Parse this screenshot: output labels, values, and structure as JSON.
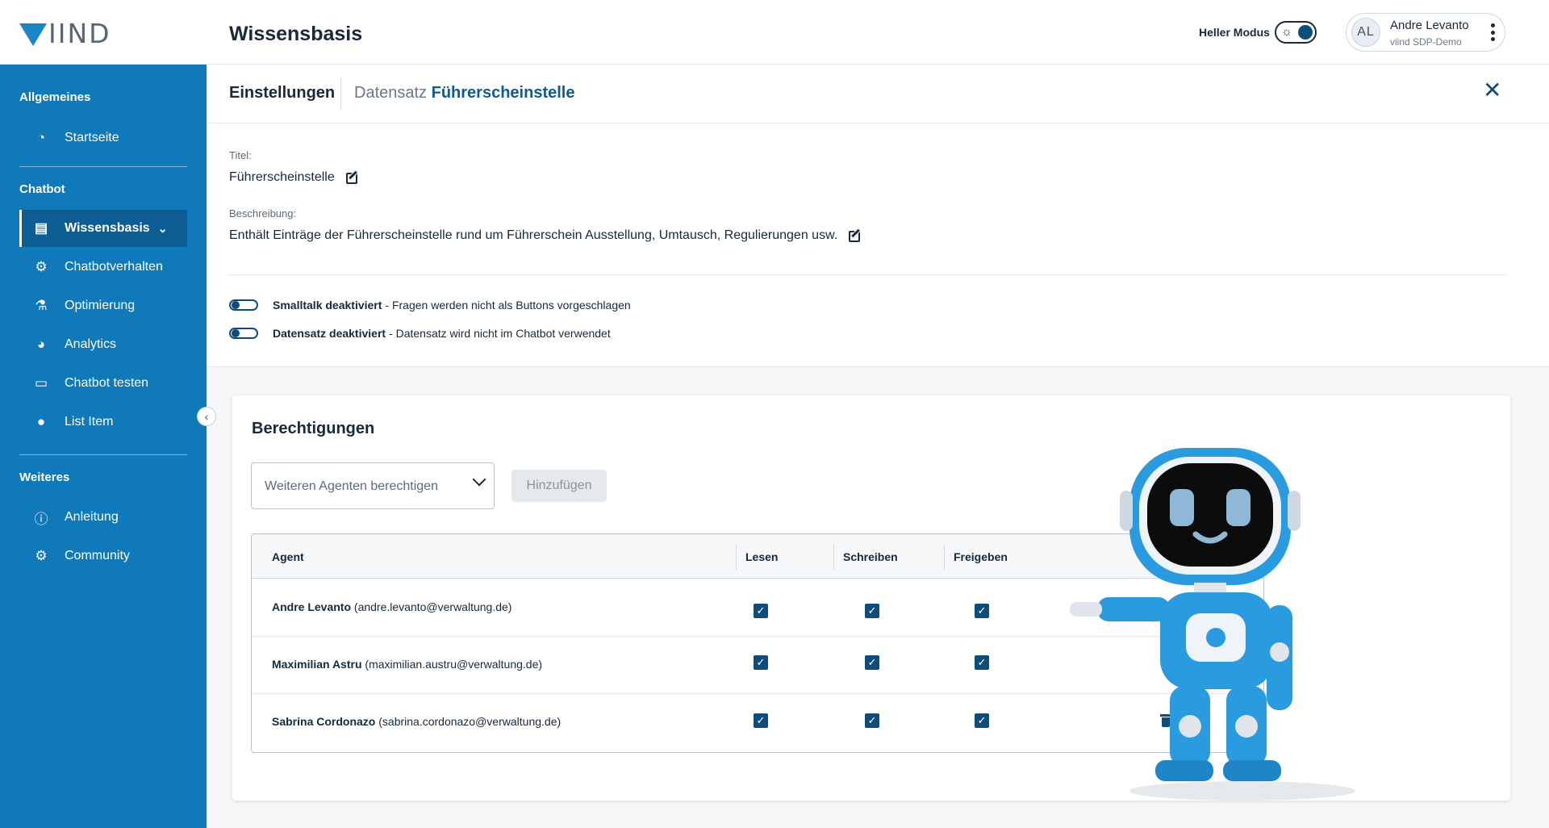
{
  "app": {
    "logo": "IIND",
    "page_title": "Wissensbasis"
  },
  "header": {
    "mode_label": "Heller Modus",
    "user": {
      "initials": "AL",
      "name": "Andre Levanto",
      "org": "viind SDP-Demo"
    }
  },
  "sidebar": {
    "sections": [
      {
        "title": "Allgemeines"
      },
      {
        "title": "Chatbot"
      },
      {
        "title": "Weiteres"
      }
    ],
    "items": [
      {
        "label": "Startseite",
        "icon": "dashboard-icon"
      },
      {
        "label": "Wissensbasis",
        "icon": "book-icon",
        "active": true
      },
      {
        "label": "Chatbotverhalten",
        "icon": "gears-icon"
      },
      {
        "label": "Optimierung",
        "icon": "microscope-icon"
      },
      {
        "label": "Analytics",
        "icon": "pie-chart-icon"
      },
      {
        "label": "Chatbot testen",
        "icon": "robot-face-icon"
      },
      {
        "label": "List Item",
        "icon": "circle-icon"
      },
      {
        "label": "Anleitung",
        "icon": "help-icon"
      },
      {
        "label": "Community",
        "icon": "gears-icon"
      }
    ]
  },
  "settings": {
    "title": "Einstellungen",
    "dataset_prefix": "Datensatz",
    "dataset_name": "Führerscheinstelle",
    "title_label": "Titel:",
    "title_value": "Führerscheinstelle",
    "desc_label": "Beschreibung:",
    "desc_value": "Enthält Einträge der Führerscheinstelle rund um Führerschein Ausstellung, Umtausch, Regulierungen usw.",
    "toggles": [
      {
        "label": "Smalltalk deaktiviert",
        "desc": "- Fragen werden nicht als Buttons vorgeschlagen",
        "on": false
      },
      {
        "label": "Datensatz deaktiviert",
        "desc": "- Datensatz wird nicht im Chatbot verwendet",
        "on": false
      }
    ]
  },
  "permissions": {
    "title": "Berechtigungen",
    "select_placeholder": "Weiteren Agenten berechtigen",
    "add_button": "Hinzufügen",
    "columns": [
      "Agent",
      "Lesen",
      "Schreiben",
      "Freigeben"
    ],
    "rows": [
      {
        "name": "Andre Levanto",
        "email": "(andre.levanto@verwaltung.de)",
        "read": true,
        "write": true,
        "share": true,
        "deletable": false
      },
      {
        "name": "Maximilian Astru",
        "email": "(maximilian.austru@verwaltung.de)",
        "read": true,
        "write": true,
        "share": true,
        "deletable": true
      },
      {
        "name": "Sabrina Cordonazo",
        "email": "(sabrina.cordonazo@verwaltung.de)",
        "read": true,
        "write": true,
        "share": true,
        "deletable": true
      }
    ]
  },
  "colors": {
    "sidebar": "#0f79ba",
    "active": "#0b5d93",
    "accent": "#0e4d7a"
  }
}
